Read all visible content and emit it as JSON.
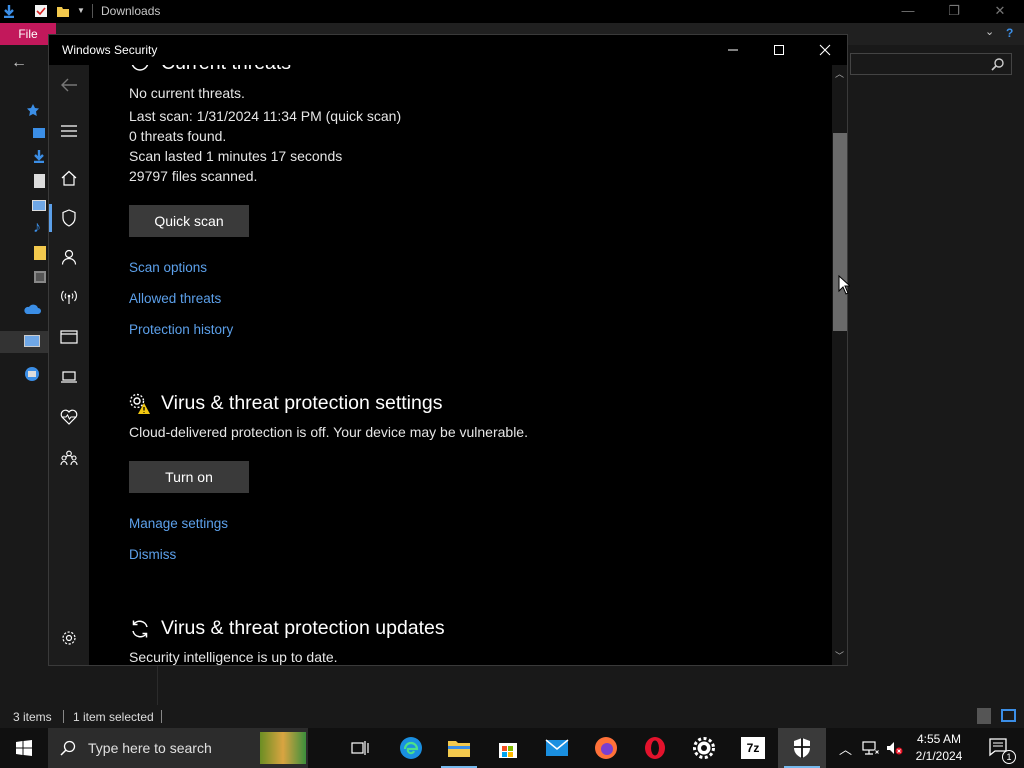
{
  "explorer": {
    "title": "Downloads",
    "file_tab": "File",
    "status_items": "3 items",
    "status_selected": "1 item selected"
  },
  "security_window": {
    "title": "Windows Security",
    "current_threats": {
      "heading": "Current threats",
      "lines": [
        "No current threats.",
        "Last scan: 1/31/2024 11:34 PM (quick scan)",
        "0 threats found.",
        "Scan lasted 1 minutes 17 seconds",
        "29797 files scanned."
      ],
      "quick_scan_button": "Quick scan",
      "links": [
        "Scan options",
        "Allowed threats",
        "Protection history"
      ]
    },
    "protection_settings": {
      "heading": "Virus & threat protection settings",
      "message": "Cloud-delivered protection is off. Your device may be vulnerable.",
      "turn_on_button": "Turn on",
      "links": [
        "Manage settings",
        "Dismiss"
      ]
    },
    "updates": {
      "heading": "Virus & threat protection updates",
      "message": "Security intelligence is up to date."
    },
    "scroll_fraction": 0.33
  },
  "taskbar": {
    "search_placeholder": "Type here to search",
    "time": "4:55 AM",
    "date": "2/1/2024",
    "notification_count": "1"
  },
  "colors": {
    "link": "#5ca0ea",
    "file_tab": "#c2185b",
    "button": "#3a3a3a"
  }
}
